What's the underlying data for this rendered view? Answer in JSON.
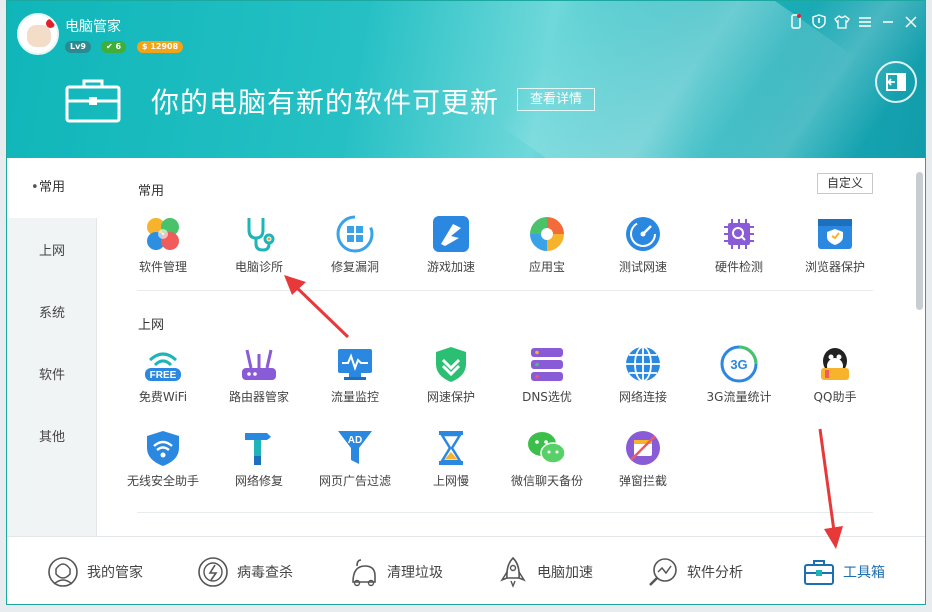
{
  "app": {
    "title": "电脑管家",
    "level": "Lv9",
    "vip": "6",
    "coins": "$ 12908"
  },
  "top_icons": [
    "phone-icon",
    "shield-icon",
    "shirt-icon",
    "menu-icon",
    "minimize-icon",
    "close-icon"
  ],
  "banner": {
    "text": "你的电脑有新的软件可更新",
    "link": "查看详情"
  },
  "sidebar": {
    "items": [
      {
        "label": "常用",
        "active": true
      },
      {
        "label": "上网",
        "active": false
      },
      {
        "label": "系统",
        "active": false
      },
      {
        "label": "软件",
        "active": false
      },
      {
        "label": "其他",
        "active": false
      }
    ]
  },
  "content": {
    "custom_button": "自定义",
    "sections": [
      {
        "title": "常用",
        "tools": [
          {
            "label": "软件管理",
            "icon": "clover-icon"
          },
          {
            "label": "电脑诊所",
            "icon": "stethoscope-icon"
          },
          {
            "label": "修复漏洞",
            "icon": "windows-repair-icon"
          },
          {
            "label": "游戏加速",
            "icon": "game-boost-icon"
          },
          {
            "label": "应用宝",
            "icon": "app-store-icon"
          },
          {
            "label": "测试网速",
            "icon": "speedometer-icon"
          },
          {
            "label": "硬件检测",
            "icon": "chip-icon"
          },
          {
            "label": "浏览器保护",
            "icon": "browser-shield-icon"
          }
        ]
      },
      {
        "title": "上网",
        "tools": [
          {
            "label": "免费WiFi",
            "icon": "free-wifi-icon",
            "tag": "FREE"
          },
          {
            "label": "路由器管家",
            "icon": "router-icon"
          },
          {
            "label": "流量监控",
            "icon": "monitor-icon"
          },
          {
            "label": "网速保护",
            "icon": "shield-check-icon"
          },
          {
            "label": "DNS选优",
            "icon": "server-icon"
          },
          {
            "label": "网络连接",
            "icon": "globe-icon"
          },
          {
            "label": "3G流量统计",
            "icon": "3g-icon",
            "tag": "3G"
          },
          {
            "label": "QQ助手",
            "icon": "qq-icon"
          },
          {
            "label": "无线安全助手",
            "icon": "wifi-shield-icon"
          },
          {
            "label": "网络修复",
            "icon": "hammer-icon"
          },
          {
            "label": "网页广告过滤",
            "icon": "ad-filter-icon",
            "tag": "AD"
          },
          {
            "label": "上网慢",
            "icon": "hourglass-icon"
          },
          {
            "label": "微信聊天备份",
            "icon": "wechat-icon"
          },
          {
            "label": "弹窗拦截",
            "icon": "popup-block-icon"
          }
        ]
      }
    ]
  },
  "bottom_nav": [
    {
      "label": "我的管家",
      "icon": "butler-icon",
      "active": false
    },
    {
      "label": "病毒查杀",
      "icon": "virus-icon",
      "active": false
    },
    {
      "label": "清理垃圾",
      "icon": "vacuum-icon",
      "active": false
    },
    {
      "label": "电脑加速",
      "icon": "rocket-icon",
      "active": false
    },
    {
      "label": "软件分析",
      "icon": "analysis-icon",
      "active": false
    },
    {
      "label": "工具箱",
      "icon": "toolbox-icon",
      "active": true
    }
  ],
  "colors": {
    "accent": "#1fb5b8",
    "red_arrow": "#e8393a",
    "active_nav": "#1e6fb0"
  }
}
